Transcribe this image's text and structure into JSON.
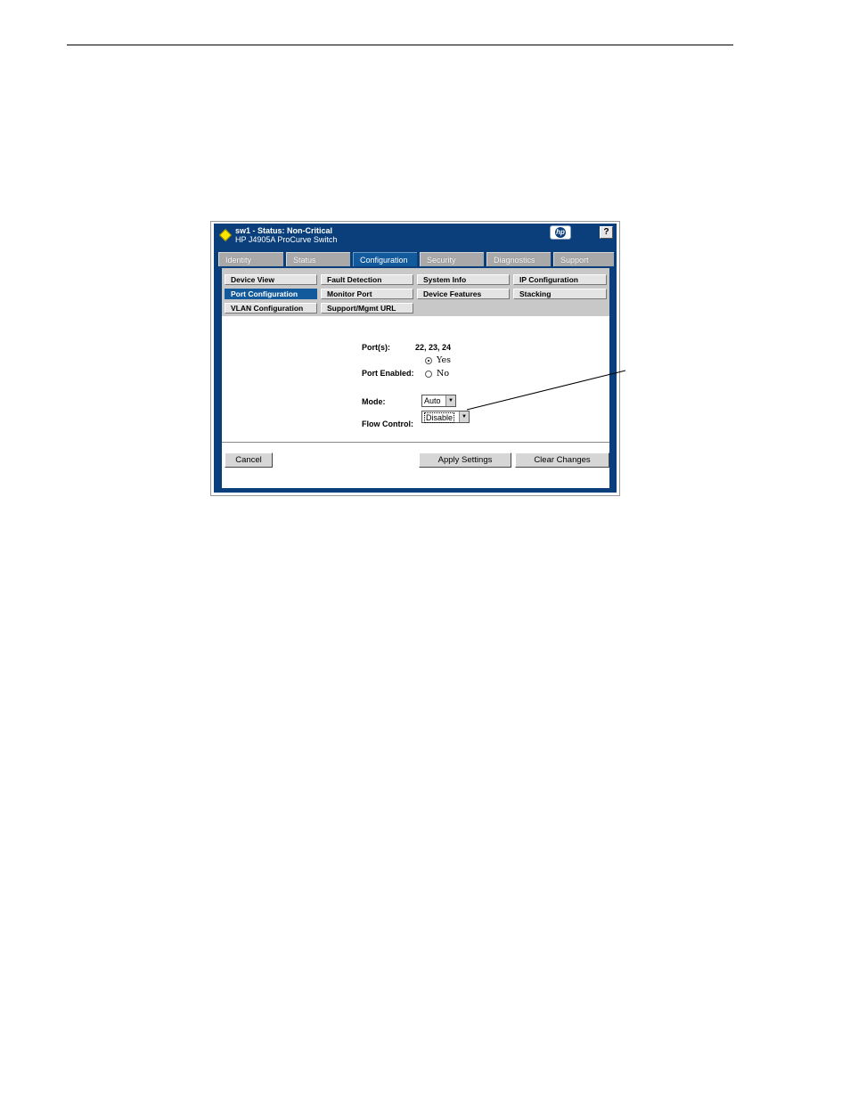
{
  "header": {
    "title": "sw1 - Status: Non-Critical",
    "subtitle": "HP J4905A ProCurve Switch",
    "help_label": "?",
    "logo_text": "hp"
  },
  "tabs": [
    {
      "label": "Identity"
    },
    {
      "label": "Status"
    },
    {
      "label": "Configuration"
    },
    {
      "label": "Security"
    },
    {
      "label": "Diagnostics"
    },
    {
      "label": "Support"
    }
  ],
  "subnav": [
    {
      "label": "Device View"
    },
    {
      "label": "Fault Detection"
    },
    {
      "label": "System Info"
    },
    {
      "label": "IP Configuration"
    },
    {
      "label": "Port Configuration"
    },
    {
      "label": "Monitor Port"
    },
    {
      "label": "Device Features"
    },
    {
      "label": "Stacking"
    },
    {
      "label": "VLAN Configuration"
    },
    {
      "label": "Support/Mgmt URL"
    }
  ],
  "form": {
    "ports_label": "Port(s):",
    "ports_value": "22, 23, 24",
    "port_enabled_label": "Port Enabled:",
    "yes_label": "Yes",
    "no_label": "No",
    "mode_label": "Mode:",
    "mode_value": "Auto",
    "flow_control_label": "Flow Control:",
    "flow_control_value": "Disable"
  },
  "buttons": {
    "cancel": "Cancel",
    "apply": "Apply Settings",
    "clear": "Clear Changes"
  },
  "colors": {
    "frame": "#0a3f7c",
    "active_tab": "#135a9c",
    "status": "#ffe600"
  }
}
